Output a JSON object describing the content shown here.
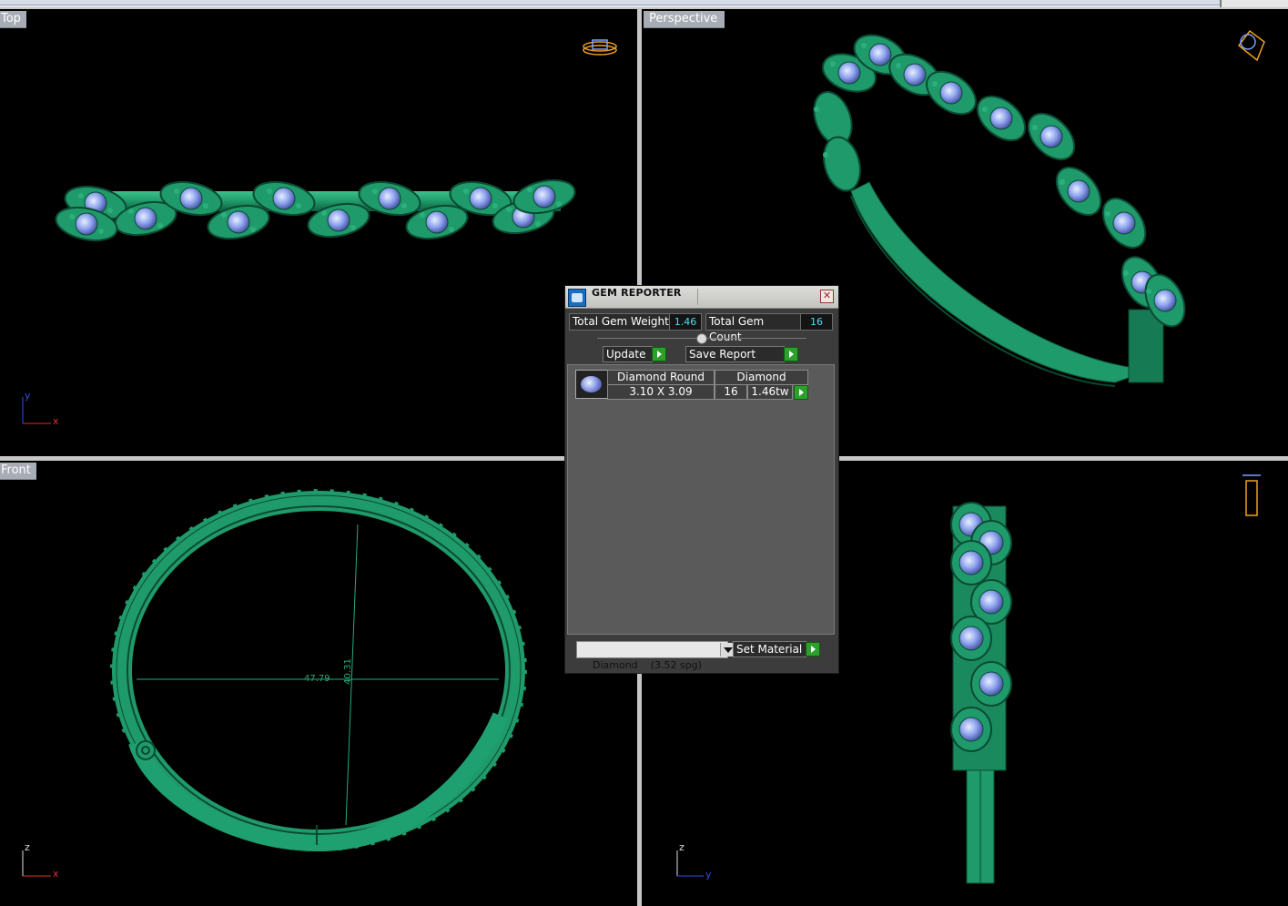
{
  "viewports": {
    "top": {
      "label": "Top",
      "axes": {
        "x": "x",
        "y": "y"
      }
    },
    "perspective": {
      "label": "Perspective"
    },
    "front": {
      "label": "Front",
      "axes": {
        "x": "x",
        "z": "z"
      },
      "dimensions": {
        "width": "47.79",
        "height": "40.31"
      }
    },
    "right": {
      "axes": {
        "y": "y",
        "z": "z"
      }
    }
  },
  "gem_reporter": {
    "title": "GEM REPORTER",
    "close_icon": "close-icon",
    "total_gem_weight_label": "Total Gem Weight",
    "total_gem_weight_value": "1.46",
    "total_gem_count_label": "Total Gem Count",
    "total_gem_count_value": "16",
    "update_label": "Update",
    "save_report_label": "Save Report",
    "gems": [
      {
        "shape": "Diamond Round",
        "material": "Diamond",
        "size": "3.10 X 3.09",
        "count": "16",
        "weight": "1.46tw"
      }
    ],
    "material_select_value": "Diamond    (3.52 spg)",
    "set_material_label": "Set Material"
  },
  "colors": {
    "metal": "#1f9a6a",
    "metal_dark": "#0f5e3e",
    "stone": "#8fa4ee",
    "viewport_bg": "#000000",
    "panel_bg": "#3c3c3c",
    "value_text": "#4fdcf0",
    "go_button": "#2ba02b"
  }
}
